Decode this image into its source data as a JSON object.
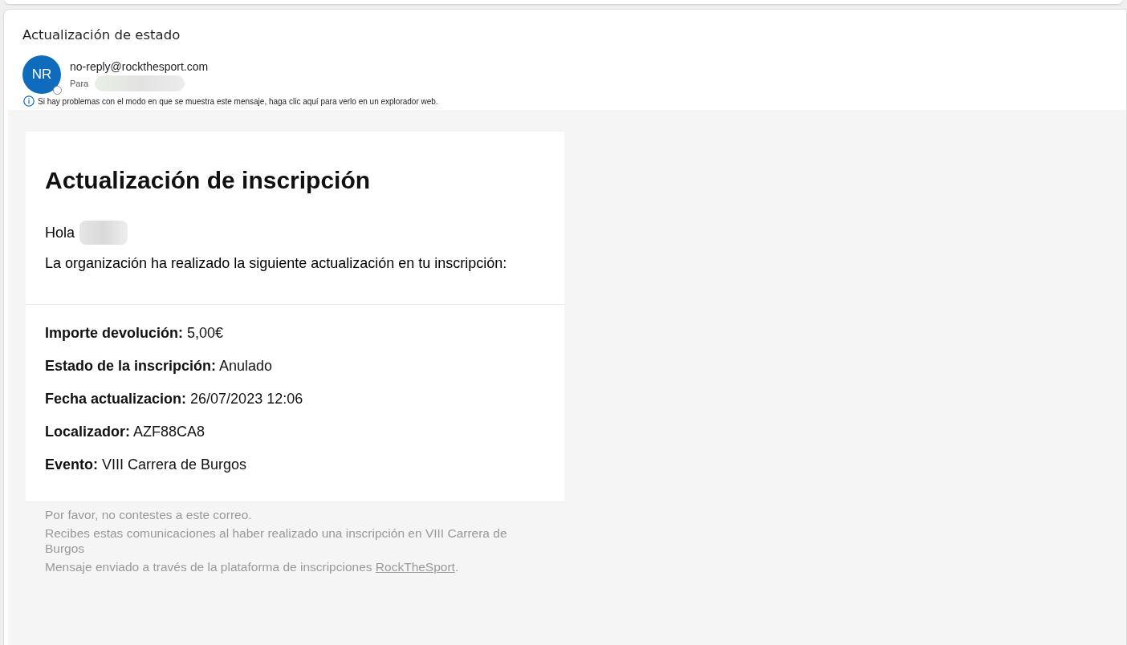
{
  "message": {
    "subject": "Actualización de estado",
    "avatar_initials": "NR",
    "sender": "no-reply@rockthesport.com",
    "to_label": "Para",
    "info_notice": "Si hay problemas con el modo en que se muestra este mensaje, haga clic aquí para verlo en un explorador web."
  },
  "email": {
    "heading": "Actualización de inscripción",
    "greeting": "Hola",
    "intro": "La organización ha realizado la siguiente actualización en tu inscripción:",
    "details": [
      {
        "label": "Importe devolución:",
        "value": "5,00€"
      },
      {
        "label": "Estado de la inscripción:",
        "value": "Anulado"
      },
      {
        "label": "Fecha actualizacion:",
        "value": "26/07/2023 12:06"
      },
      {
        "label": "Localizador:",
        "value": "AZF88CA8"
      },
      {
        "label": "Evento:",
        "value": "VIII Carrera de Burgos"
      }
    ]
  },
  "footer": {
    "lines": [
      "Por favor, no contestes a este correo.",
      "Recibes estas comunicaciones al haber realizado una inscripción en VIII Carrera de Burgos"
    ],
    "platform_text": "Mensaje enviado a través de la plataforma de inscripciones",
    "platform_link": "RockTheSport",
    "platform_end": "."
  }
}
